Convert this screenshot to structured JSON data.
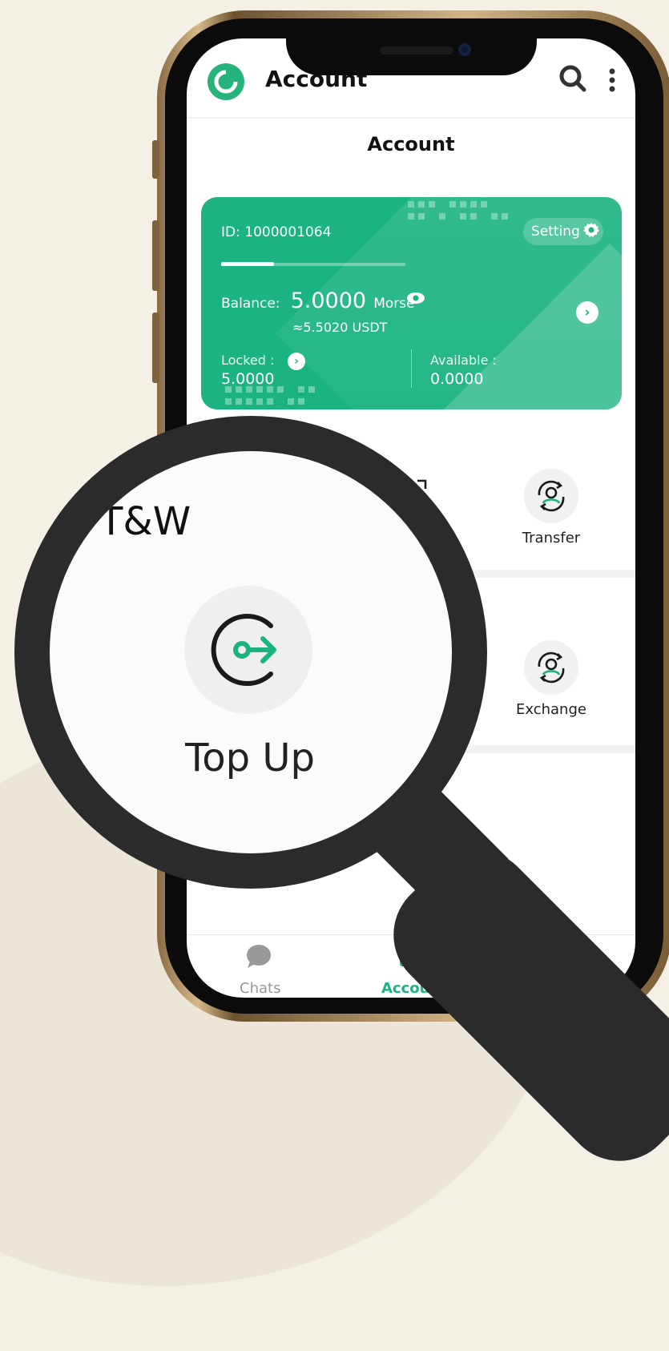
{
  "header": {
    "app_title": "Account",
    "logo_icon": "app-logo-icon",
    "search_icon": "search-icon",
    "more_icon": "more-vertical-icon"
  },
  "page_title": "Account",
  "card": {
    "id_label": "ID:",
    "id_value": "1000001064",
    "setting_label": "Setting",
    "balance_label": "Balance:",
    "balance_value": "5.0000",
    "balance_unit": "Morse",
    "balance_usdt": "≈5.5020 USDT",
    "locked_label": "Locked :",
    "locked_value": "5.0000",
    "available_label": "Available :",
    "available_value": "0.0000",
    "color": "#1bb382"
  },
  "grid": {
    "items": [
      {
        "label": "Transfer",
        "icon": "transfer-icon"
      },
      {
        "label": "Exchange",
        "icon": "exchange-icon"
      }
    ]
  },
  "magnifier": {
    "section_title": "T&W",
    "item_label": "Top Up",
    "item_icon": "top-up-icon"
  },
  "bottom_nav": {
    "items": [
      {
        "label": "Chats",
        "icon": "chat-icon",
        "active": false
      },
      {
        "label": "Account",
        "icon": "wallet-icon",
        "active": true
      }
    ]
  },
  "colors": {
    "accent": "#1bb382",
    "active_nav": "#1bb382",
    "inactive_nav": "#999999"
  }
}
